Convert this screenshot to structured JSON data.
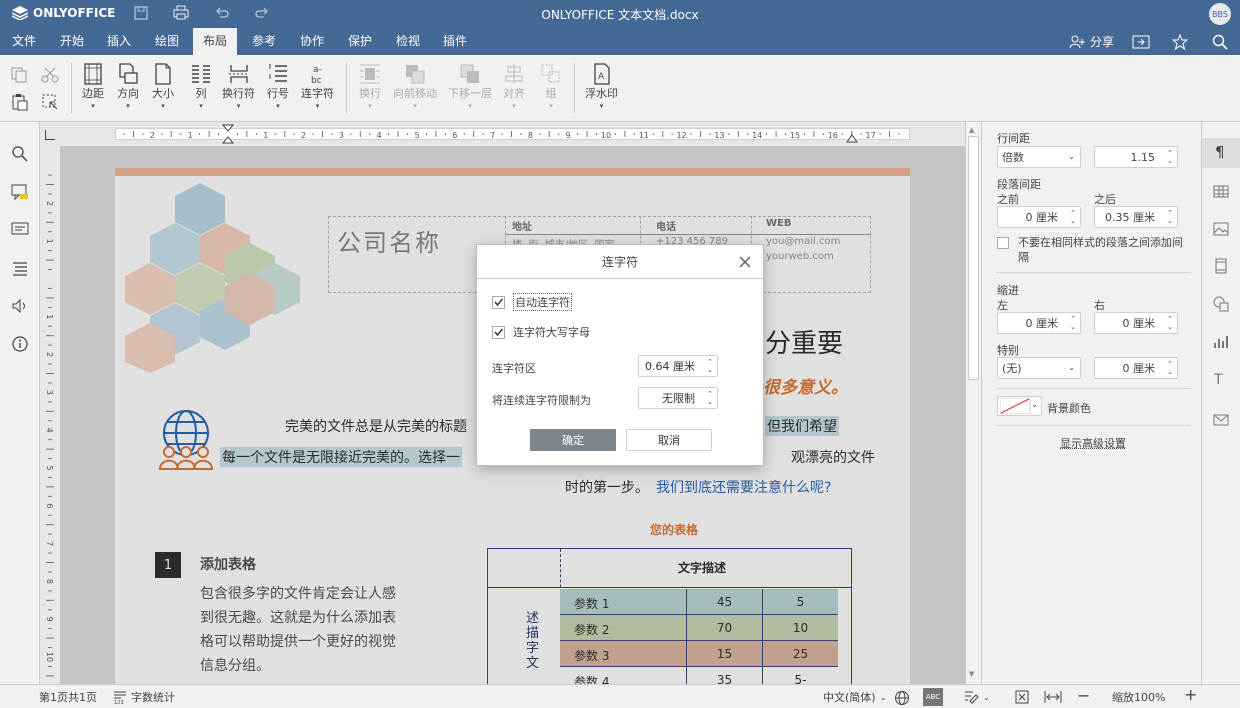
{
  "app": {
    "brand": "ONLYOFFICE",
    "doc_title": "ONLYOFFICE 文本文档.docx",
    "user_initials": "BBS"
  },
  "tabs": [
    "文件",
    "开始",
    "插入",
    "绘图",
    "布局",
    "参考",
    "协作",
    "保护",
    "检视",
    "插件"
  ],
  "active_tab": "布局",
  "header_right": {
    "share_label": "分享"
  },
  "toolbar": {
    "margins": "边距",
    "orientation": "方向",
    "size": "大小",
    "columns": "列",
    "breaks": "换行符",
    "line_numbers": "行号",
    "hyphenation": "连字符",
    "wrap": "换行",
    "bring_forward": "向前移动",
    "send_backward": "下移一层",
    "align": "对齐",
    "group": "组",
    "watermark": "浮水印"
  },
  "ruler_numbers": [
    "2",
    "1",
    "1",
    "2",
    "3",
    "4",
    "5",
    "6",
    "7",
    "8",
    "9",
    "10",
    "11",
    "12",
    "13",
    "14",
    "15",
    "16",
    "17"
  ],
  "vruler_numbers": [
    "3",
    "2",
    "1",
    "1",
    "2",
    "3",
    "4",
    "5",
    "6",
    "7",
    "8",
    "9",
    "10"
  ],
  "document": {
    "company": "公司名称",
    "col_address": "地址",
    "col_phone": "电话",
    "col_web": "WEB",
    "address_text": "楼, 街, 城市/地区, 国家",
    "phone_text": "+123 456 789",
    "web_mail": "you@mail.com",
    "web_site": "yourweb.com",
    "headline": "分重要",
    "subheadline": "很多意义。",
    "para1_a": "完美的文件总是从完美的标题",
    "para1_b": "但我们希望",
    "para2_a": "每一个文件是无限接近完美的。选择一",
    "para2_b": "观漂亮的文件",
    "para3_a": "时的第一步。",
    "para3_link": "我们到底还需要注意什么呢?",
    "table_caption": "您的表格",
    "table_header": "文字描述",
    "table_side": "述描字文",
    "rows": [
      {
        "label": "参数 1",
        "a": "45",
        "b": "5",
        "color": "#bcd6d9"
      },
      {
        "label": "参数 2",
        "a": "70",
        "b": "10",
        "color": "#c9d7b3"
      },
      {
        "label": "参数 3",
        "a": "15",
        "b": "25",
        "color": "#dcb8a2"
      },
      {
        "label": "参数 4",
        "a": "35",
        "b": "5-",
        "color": "#ffffff"
      }
    ],
    "section_number": "1",
    "section_title": "添加表格",
    "section_body": [
      "包含很多字的文件肯定会让人感",
      "到很无趣。这就是为什么添加表",
      "格可以帮助提供一个更好的视觉",
      "信息分组。"
    ]
  },
  "right_panel": {
    "line_spacing_label": "行间距",
    "line_spacing_type": "倍数",
    "line_spacing_value": "1.15",
    "para_spacing_label": "段落间距",
    "before_label": "之前",
    "after_label": "之后",
    "before_value": "0 厘米",
    "after_value": "0.35 厘米",
    "no_space_same_style": "不要在相同样式的段落之间添加间隔",
    "indent_label": "缩进",
    "left_label": "左",
    "right_label": "右",
    "left_value": "0 厘米",
    "right_value": "0 厘米",
    "special_label": "特别",
    "special_value": "(无)",
    "special_amount": "0 厘米",
    "bg_color_label": "背景颜色",
    "advanced_link": "显示高级设置"
  },
  "status": {
    "page_info": "第1页共1页",
    "word_count": "字数统计",
    "language": "中文(简体)",
    "zoom": "缩放100%"
  },
  "dialog": {
    "title": "连字符",
    "auto_hyphen": "自动连字符",
    "auto_checked": true,
    "caps_hyphen": "连字符大写字母",
    "caps_checked": true,
    "zone_label": "连字符区",
    "zone_value": "0.64 厘米",
    "limit_label": "将连续连字符限制为",
    "limit_value": "无限制",
    "ok": "确定",
    "cancel": "取消"
  },
  "colors": {
    "brand": "#446995",
    "orange": "#e07b3b",
    "link": "#2a6bb8",
    "dark": "#333333"
  }
}
